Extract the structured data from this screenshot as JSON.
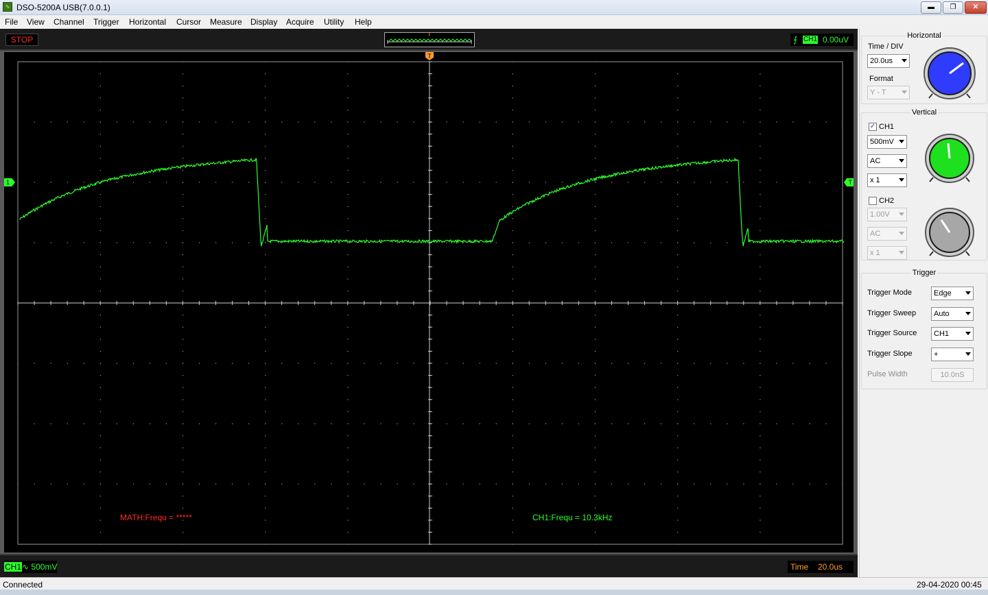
{
  "window": {
    "title": "DSO-5200A USB(7.0.0.1)",
    "minimize": "▬",
    "restore": "❐",
    "close": "✕"
  },
  "menu": [
    "File",
    "View",
    "Channel",
    "Trigger",
    "Horizontal",
    "Cursor",
    "Measure",
    "Display",
    "Acquire",
    "Utility",
    "Help"
  ],
  "toolbar": {
    "run_state": "STOP",
    "trigger_marker": "T",
    "trig_channel": "CH1",
    "trig_level": "0.00uV"
  },
  "screen": {
    "trigger_pos_marker": "T",
    "ch1_marker": "1",
    "trig_level_marker": "T",
    "math_readout": "MATH:Frequ = *****",
    "ch1_readout": "CH1:Frequ = 10.3kHz",
    "colors": {
      "trace": "#2cff2c",
      "grid": "#9a9a9a",
      "math_text": "#ff2b2b",
      "ch1_text": "#2cff2c",
      "marker": "#ff9b2c"
    }
  },
  "bottom": {
    "ch1_label": "CH1",
    "ch1_coupling_symbol": "∿",
    "ch1_scale": "500mV",
    "time_label": "Time",
    "time_value": "20.0us"
  },
  "status": {
    "left": "Connected",
    "right": "29-04-2020  00:45"
  },
  "panel": {
    "horizontal": {
      "title": "Horizontal",
      "timediv_label": "Time / DIV",
      "timediv_value": "20.0us",
      "format_label": "Format",
      "format_value": "Y - T",
      "knob_color": "#2f3cff"
    },
    "vertical": {
      "title": "Vertical",
      "ch1_label": "CH1",
      "ch1_checked": "✓",
      "ch1_volts": "500mV",
      "ch1_coupling": "AC",
      "ch1_probe": "x 1",
      "ch1_knob_color": "#1fe01f",
      "ch2_label": "CH2",
      "ch2_volts": "1.00V",
      "ch2_coupling": "AC",
      "ch2_probe": "x 1",
      "ch2_knob_color": "#a7a7a7"
    },
    "trigger": {
      "title": "Trigger",
      "mode_label": "Trigger Mode",
      "mode_value": "Edge",
      "sweep_label": "Trigger Sweep",
      "sweep_value": "Auto",
      "source_label": "Trigger Source",
      "source_value": "CH1",
      "slope_label": "Trigger Slope",
      "slope_value": "+",
      "pulse_label": "Pulse Width",
      "pulse_value": "10.0nS"
    }
  }
}
